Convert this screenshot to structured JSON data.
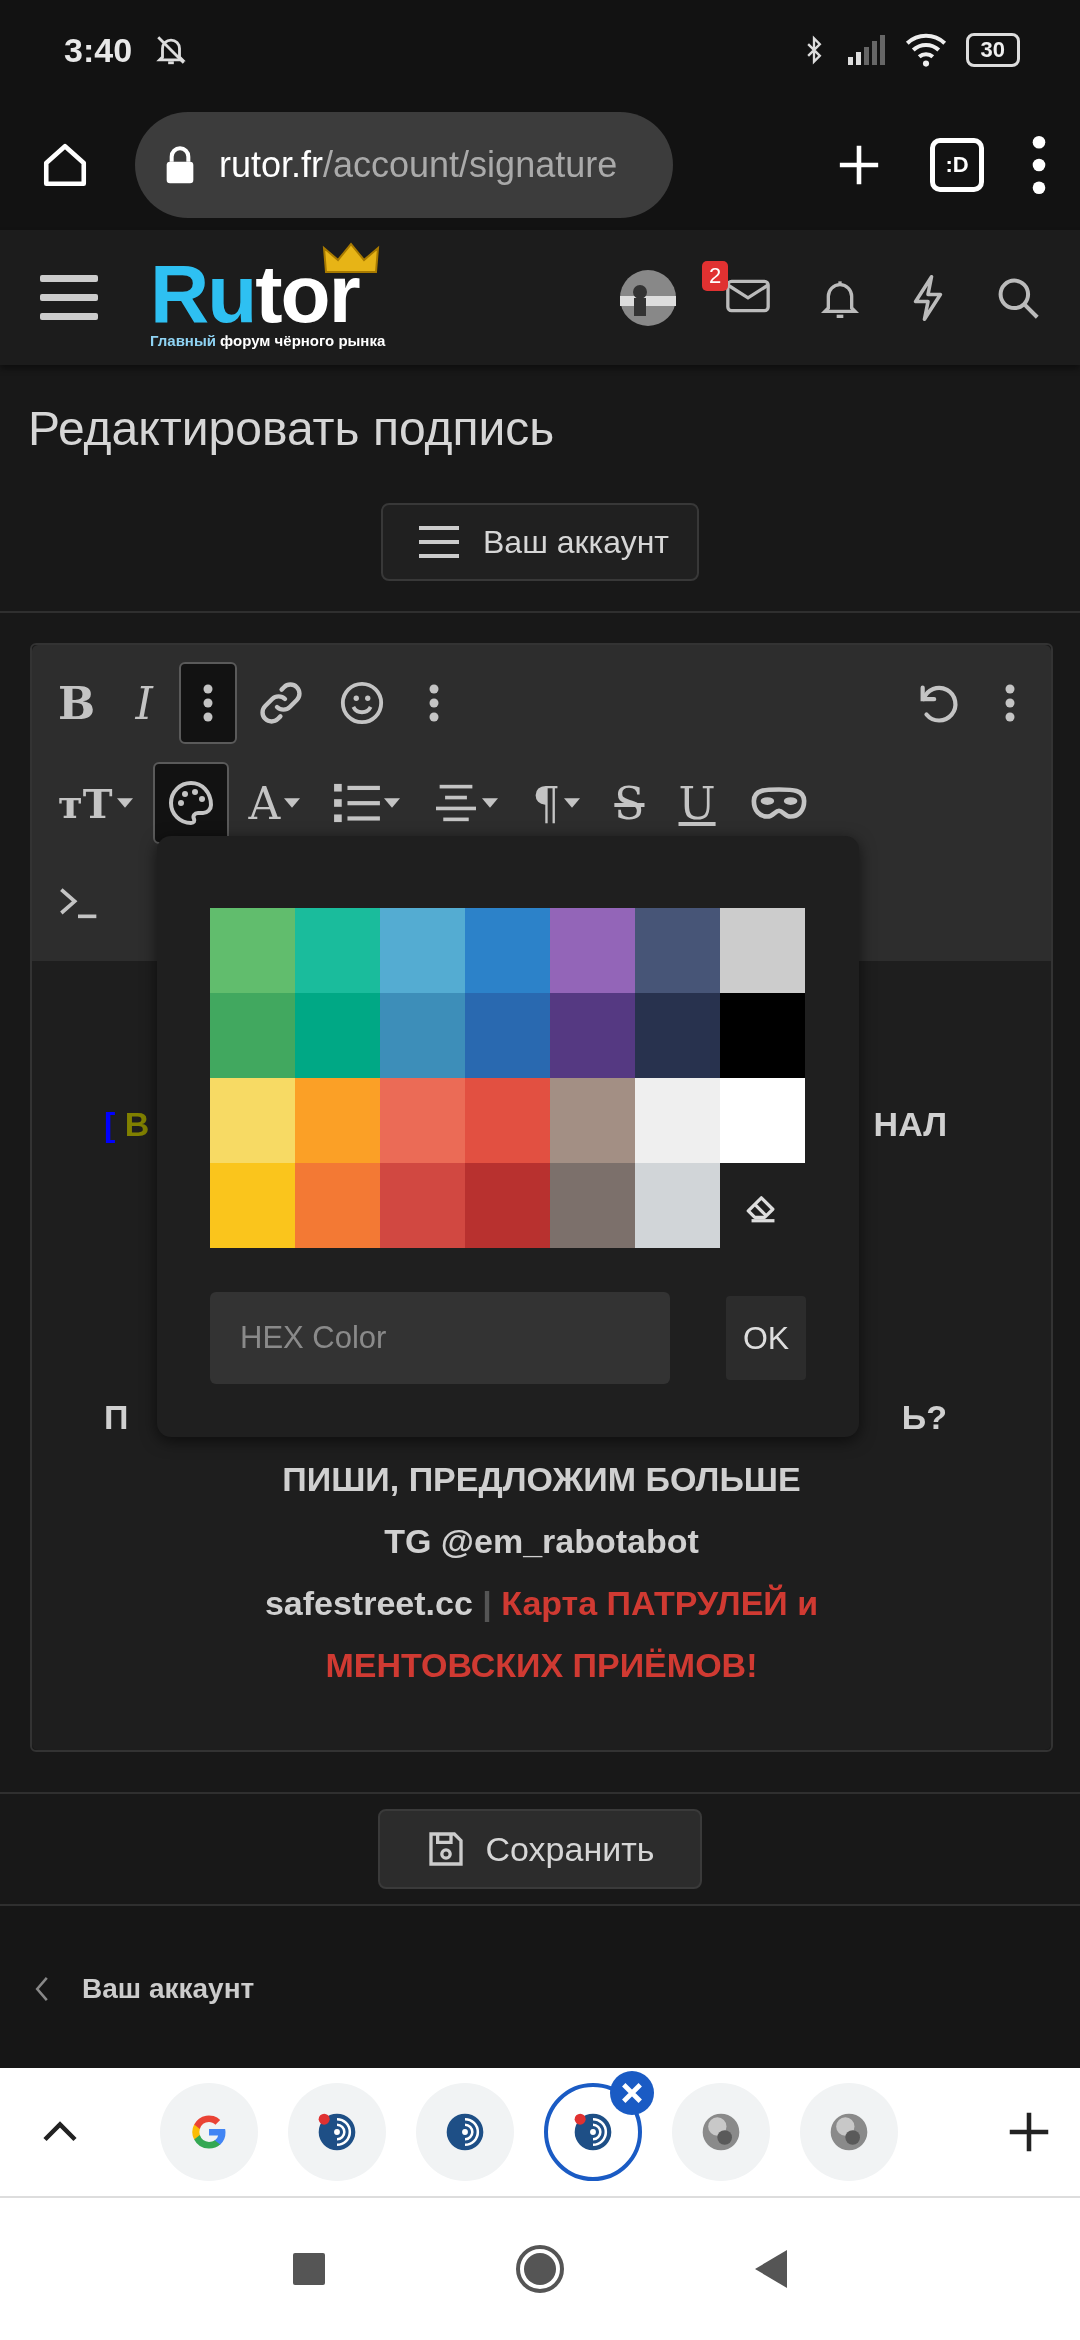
{
  "status_bar": {
    "time": "3:40",
    "battery": "30"
  },
  "browser": {
    "url_host": "rutor.fr",
    "url_path": "/account/signature",
    "tab_switcher": ":D"
  },
  "site_header": {
    "logo_lead": "Ru",
    "logo_rest": "tor",
    "tagline_lead": "Главный",
    "tagline_rest": " форум чёрного рынка",
    "messages_badge": "2"
  },
  "page_title": "Редактировать подпись",
  "account_menu_button": "Ваш аккаунт",
  "editor": {
    "toolbar_rows": [
      {
        "tools": [
          {
            "kind": "bold",
            "glyph": "B"
          },
          {
            "kind": "italic",
            "glyph": "I"
          },
          {
            "kind": "more",
            "selected": true
          },
          {
            "kind": "link"
          },
          {
            "kind": "smile"
          },
          {
            "kind": "more",
            "selected": false
          },
          {
            "kind": "spacer"
          },
          {
            "kind": "undo"
          },
          {
            "kind": "more",
            "selected": false
          }
        ]
      },
      {
        "tools": [
          {
            "kind": "size",
            "glyph": "тT"
          },
          {
            "kind": "palette",
            "selected": true
          },
          {
            "kind": "textcolor",
            "glyph": "A"
          },
          {
            "kind": "list"
          },
          {
            "kind": "align"
          },
          {
            "kind": "paragraph",
            "glyph": "¶"
          },
          {
            "kind": "strike",
            "glyph": "S"
          },
          {
            "kind": "underline",
            "glyph": "U"
          },
          {
            "kind": "mask"
          }
        ]
      },
      {
        "tools": [
          {
            "kind": "terminal"
          }
        ]
      }
    ],
    "lines": [
      {
        "parts": [
          [
            {
              "text": "[",
              "color": "#0000ff"
            },
            {
              "text": " В",
              "color": "#808000"
            }
          ],
          [
            {
              "text": "НАЛ",
              "color": "#d0d0d0"
            }
          ]
        ]
      },
      {
        "kind": "gap"
      },
      {
        "parts": [
          [
            {
              "text": "П",
              "color": "#d0d0d0"
            }
          ],
          [
            {
              "text": "Ь?",
              "color": "#d0d0d0"
            }
          ]
        ]
      },
      {
        "parts": [
          [
            {
              "text": "ПИШИ, ПРЕДЛОЖИМ БОЛЬШЕ",
              "color": "#d0d0d0"
            }
          ]
        ]
      },
      {
        "parts": [
          [
            {
              "text": "TG @em_rabotabot",
              "color": "#d0d0d0"
            }
          ]
        ]
      },
      {
        "parts": [
          [
            {
              "text": "safestreet.cc",
              "color": "#d0d0d0"
            },
            {
              "text": " | ",
              "color": "#555555"
            },
            {
              "text": "Карта ПАТРУЛЕЙ и",
              "color": "#d03a32"
            }
          ]
        ]
      },
      {
        "parts": [
          [
            {
              "text": "МЕНТОВСКИХ ПРИЁМОВ!",
              "color": "#d03a32"
            }
          ]
        ]
      }
    ],
    "color_picker": {
      "swatches": [
        {
          "color": "#61bd6d"
        },
        {
          "color": "#1abc9c"
        },
        {
          "color": "#54acd2"
        },
        {
          "color": "#2c82c9"
        },
        {
          "color": "#9365b8"
        },
        {
          "color": "#475577"
        },
        {
          "color": "#cccccc"
        },
        {
          "color": "#41a85f"
        },
        {
          "color": "#00a885"
        },
        {
          "color": "#3d8eb9"
        },
        {
          "color": "#2969b0"
        },
        {
          "color": "#553982"
        },
        {
          "color": "#28324e"
        },
        {
          "color": "#000000"
        },
        {
          "color": "#f7da64"
        },
        {
          "color": "#fba026"
        },
        {
          "color": "#eb6b56"
        },
        {
          "color": "#e25041"
        },
        {
          "color": "#a38f84"
        },
        {
          "color": "#efefef"
        },
        {
          "color": "#ffffff"
        },
        {
          "color": "#fac51c"
        },
        {
          "color": "#f37934"
        },
        {
          "color": "#d14841"
        },
        {
          "color": "#b8312f"
        },
        {
          "color": "#7c706b"
        },
        {
          "color": "#d1d5d8"
        }
      ],
      "hex_placeholder": "HEX Color",
      "ok_button": "OK"
    }
  },
  "save_button": "Сохранить",
  "breadcrumb_bottom": "Ваш аккаунт",
  "tab_strip": {
    "tabs": [
      {
        "kind": "g",
        "selected": false
      },
      {
        "kind": "disc-dot",
        "selected": false
      },
      {
        "kind": "disc",
        "selected": false
      },
      {
        "kind": "disc-dot",
        "selected": true
      },
      {
        "kind": "sphere",
        "selected": false
      },
      {
        "kind": "sphere",
        "selected": false
      }
    ]
  }
}
